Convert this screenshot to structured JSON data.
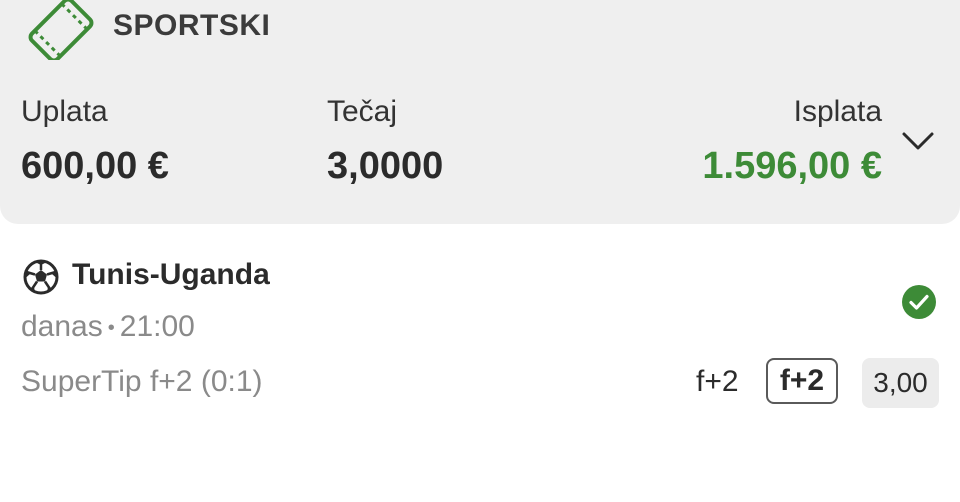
{
  "ticket": {
    "type_label": "SPORTSKI",
    "stake_label": "Uplata",
    "stake_value": "600,00 €",
    "odds_label": "Tečaj",
    "odds_value": "3,0000",
    "payout_label": "Isplata",
    "payout_value": "1.596,00 €",
    "payout_color": "#3d8b37",
    "accent_color": "#3d8b37",
    "icons": {
      "ticket": "ticket-icon",
      "expand": "chevron-down-icon"
    }
  },
  "event": {
    "sport_icon": "soccer-ball-icon",
    "name": "Tunis-Uganda",
    "day": "danas",
    "separator": "•",
    "time": "21:00",
    "market": "SuperTip f+2 (0:1)",
    "selection_text": "f+2",
    "selection_badge": "f+2",
    "odds": "3,00",
    "status_icon": "check-circle-icon",
    "status_color": "#3d8b37"
  }
}
